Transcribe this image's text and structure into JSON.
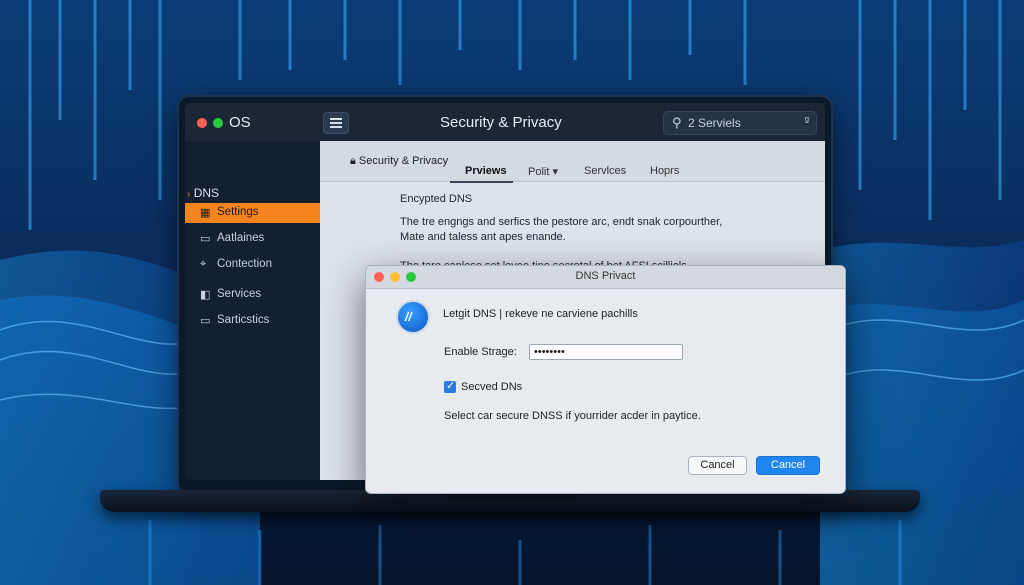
{
  "window": {
    "os_label": "OS",
    "title": "Security & Privacy",
    "search_text": "2 Serviels",
    "search_glyph": "ᵍ"
  },
  "sidebar": {
    "header": "DNS",
    "items": [
      {
        "icon": "settings-icon",
        "label": "Settings",
        "active": true
      },
      {
        "icon": "accounts-icon",
        "label": "Aatlaines"
      },
      {
        "icon": "connection-icon",
        "label": "Contection"
      },
      {
        "icon": "services-icon",
        "label": "Services"
      },
      {
        "icon": "statistics-icon",
        "label": "Sarticstics"
      }
    ]
  },
  "content": {
    "lock_label": "Security & Privacy",
    "tabs": [
      {
        "label": "Prviews",
        "active": true
      },
      {
        "label": "Polit ▾"
      },
      {
        "label": "Servlces"
      },
      {
        "label": "Hoprs"
      }
    ],
    "heading": "Encypted DNS",
    "paragraph_1a": "The tre engngs and serfics the pestore arc, endt snak corpourther,",
    "paragraph_1b": "Mate and taless ant apes enande.",
    "paragraph_2": "The tare canlese set lovee tine secrotal of bet AFSI scilliols."
  },
  "dialog": {
    "title": "DNS Privact",
    "header_line": "Letgit DNS  |  rekeve ne carviene pachills",
    "field_label": "Enable Strage:",
    "field_value": "••••••••",
    "checkbox_label": "Secved DNs",
    "checkbox_checked": true,
    "description": "Select car secure DNSS if yourrider acder in paytice.",
    "secondary_button": "Cancel",
    "primary_button": "Cancel"
  },
  "colors": {
    "accent_orange": "#f5841f",
    "primary_blue": "#1e86ee"
  }
}
